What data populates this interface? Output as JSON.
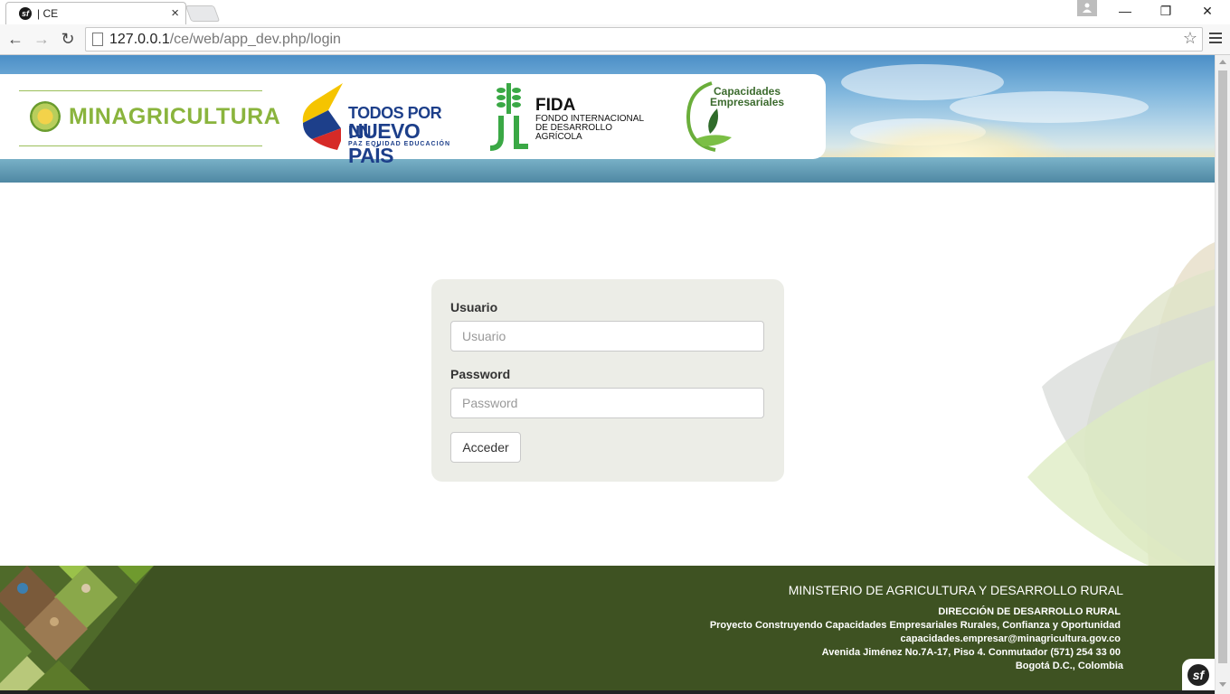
{
  "browser": {
    "tab": {
      "title": "| CE",
      "favicon_glyph": "sf"
    },
    "url": {
      "host": "127.0.0.1",
      "path": "/ce/web/app_dev.php/login"
    },
    "window_controls": {
      "minimize": "—",
      "restore": "❐",
      "close": "✕"
    },
    "nav": {
      "back": "←",
      "forward": "→",
      "reload": "↻",
      "star": "☆"
    }
  },
  "header": {
    "logos": {
      "minagricultura": "MINAGRICULTURA",
      "todos_por_un": "TODOS POR UN",
      "nuevo_pais": "NUEVO PAÍS",
      "tpun_tagline": "PAZ  EQUIDAD  EDUCACIÓN",
      "fida_name": "FIDA",
      "fida_sub": "FONDO INTERNACIONAL DE DESARROLLO AGRÍCOLA",
      "capacidades": "Capacidades",
      "empresariales": "Empresariales"
    }
  },
  "login": {
    "username_label": "Usuario",
    "username_placeholder": "Usuario",
    "username_value": "",
    "password_label": "Password",
    "password_placeholder": "Password",
    "password_value": "",
    "submit_label": "Acceder"
  },
  "footer": {
    "title": "MINISTERIO DE AGRICULTURA Y DESARROLLO RURAL",
    "lines": [
      "DIRECCIÓN DE DESARROLLO RURAL",
      "Proyecto Construyendo Capacidades Empresariales Rurales, Confianza y Oportunidad",
      "capacidades.empresar@minagricultura.gov.co",
      "Avenida Jiménez No.7A-17, Piso 4. Conmutador (571) 254 33 00",
      "Bogotá D.C., Colombia"
    ]
  },
  "debug_toolbar": {
    "glyph": "sf"
  },
  "colors": {
    "footer_bg": "#3e5222",
    "login_card_bg": "#ecede7",
    "minagricultura_green": "#8ab43d",
    "tpun_blue": "#1d3f8a"
  }
}
